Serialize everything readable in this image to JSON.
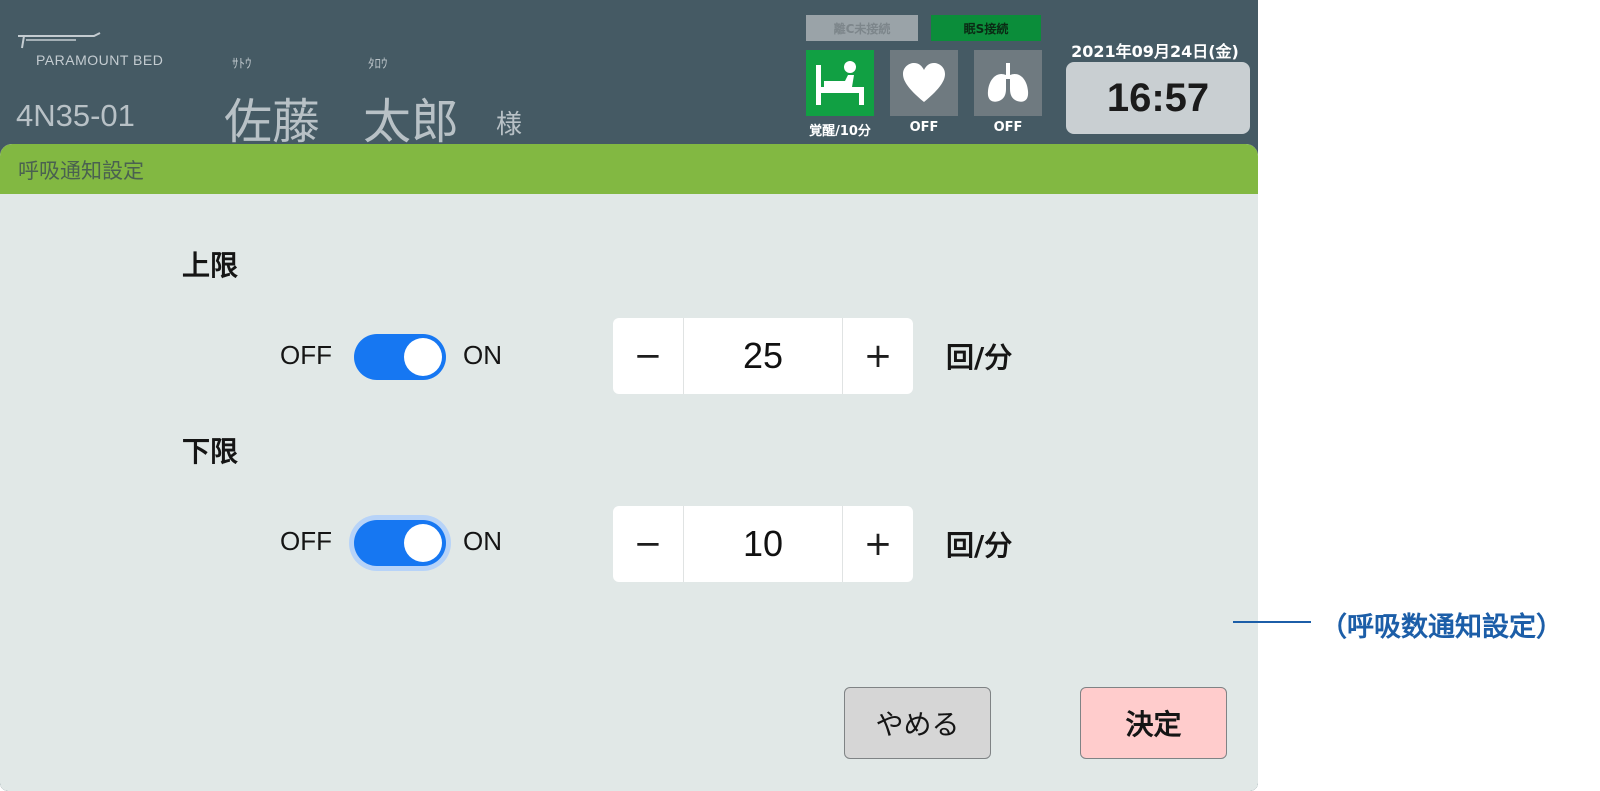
{
  "header": {
    "logo_text": "PARAMOUNT BED",
    "room": "4N35-01",
    "patient": {
      "last_kana": "ｻﾄｳ",
      "first_kana": "ﾀﾛｳ",
      "last_name": "佐藤",
      "first_name": "太郎",
      "honorific": "様"
    },
    "connections": [
      {
        "label": "離C未接続",
        "active": false
      },
      {
        "label": "眠S接続",
        "active": true
      }
    ],
    "status_items": [
      {
        "icon": "bed-icon",
        "label": "覚醒/10分",
        "active": true
      },
      {
        "icon": "heart-icon",
        "label": "OFF",
        "active": false
      },
      {
        "icon": "lungs-icon",
        "label": "OFF",
        "active": false
      }
    ],
    "date": "2021年09月24日(金)",
    "time": "16:57"
  },
  "dialog": {
    "title": "呼吸通知設定",
    "upper": {
      "label": "上限",
      "off_label": "OFF",
      "on_label": "ON",
      "enabled": true,
      "minus": "−",
      "plus": "+",
      "value": "25",
      "unit": "回/分"
    },
    "lower": {
      "label": "下限",
      "off_label": "OFF",
      "on_label": "ON",
      "enabled": true,
      "minus": "−",
      "plus": "+",
      "value": "10",
      "unit": "回/分"
    },
    "cancel_label": "やめる",
    "ok_label": "決定"
  },
  "annotation": {
    "text": "（呼吸数通知設定）"
  },
  "colors": {
    "header_bg": "#455a64",
    "dialog_bar": "#82b842",
    "dialog_bg": "#e1e8e7",
    "toggle_on": "#1677f2",
    "ok_button": "#ffcccc",
    "status_active": "#11a043",
    "annotation": "#1c5ea8"
  }
}
